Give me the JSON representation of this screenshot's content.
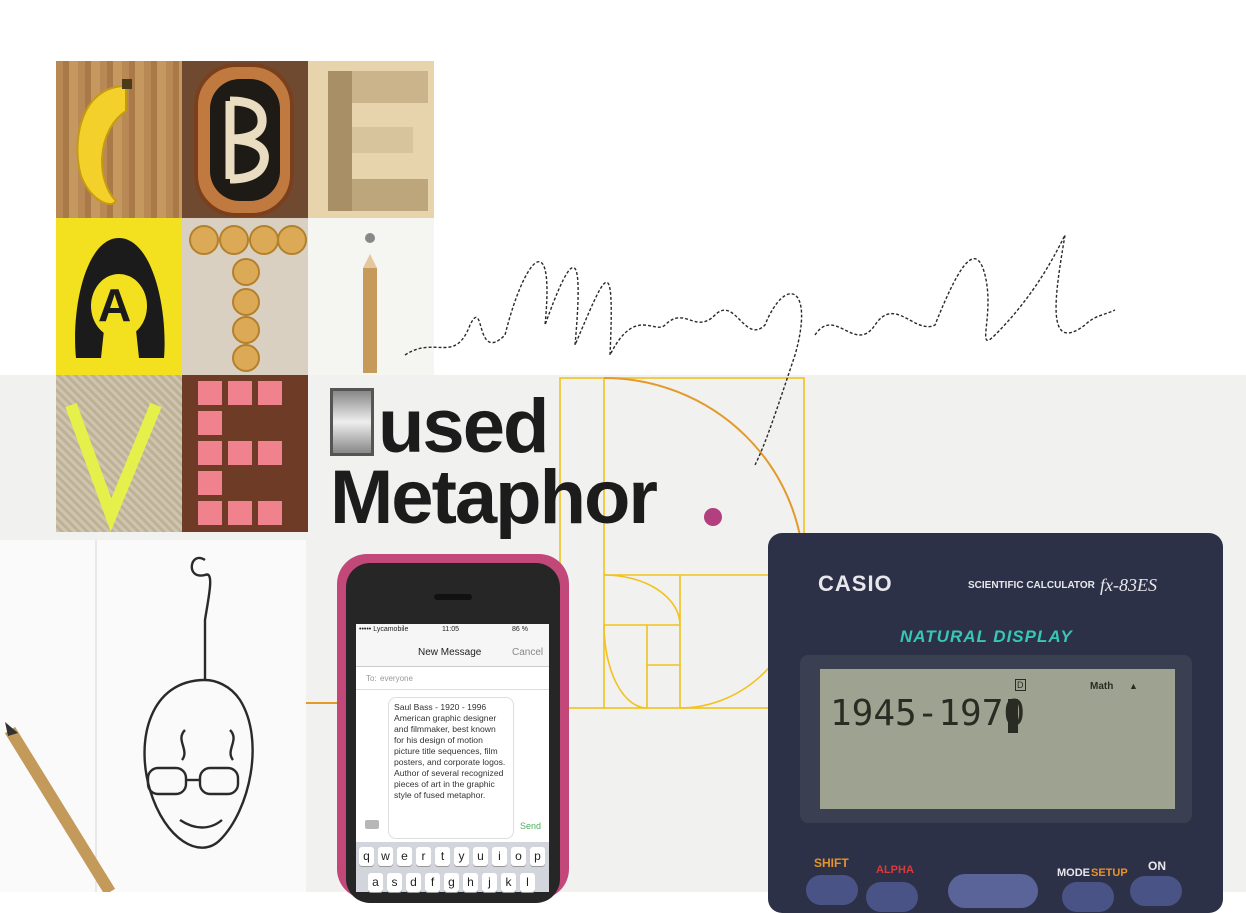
{
  "headline": {
    "line1_rest": "used",
    "line2": "Metaphor"
  },
  "script_word": "intelligent",
  "phone": {
    "carrier": "••••• Lycamobile",
    "time": "11:05",
    "battery": "86 %",
    "nav_title": "New Message",
    "cancel": "Cancel",
    "to_label": "To:",
    "to_value": "everyone",
    "message": "Saul Bass - 1920 - 1996 American graphic designer and filmmaker, best known for his design of motion picture title sequences, film posters, and corporate logos. Author of several recognized pieces of art in the graphic style of fused metaphor.",
    "send": "Send",
    "keyboard_row1": [
      "q",
      "w",
      "e",
      "r",
      "t",
      "y",
      "u",
      "i",
      "o",
      "p"
    ],
    "keyboard_row2": [
      "a",
      "s",
      "d",
      "f",
      "g",
      "h",
      "j",
      "k",
      "l"
    ]
  },
  "calculator": {
    "brand": "CASIO",
    "model_label": "SCIENTIFIC CALCULATOR",
    "model": "fx-83ES",
    "natural_display": "NATURAL DISPLAY",
    "lcd_value": "1945-1970",
    "lcd_indicator_d": "D",
    "lcd_indicator_math": "Math",
    "shift": "SHIFT",
    "alpha": "ALPHA",
    "mode": "MODE",
    "setup": "SETUP",
    "on": "ON"
  },
  "tiles": {
    "letter_a": "A"
  },
  "colors": {
    "accent_magenta": "#b2407f",
    "golden_spiral": "#f2c21b",
    "spiral_orange": "#e39a2a",
    "calc_body": "#2d3147",
    "lcd_green": "#9ea290",
    "natural_display_teal": "#36c8b4",
    "shift_orange": "#e6932a",
    "alpha_red": "#d93a3a"
  }
}
